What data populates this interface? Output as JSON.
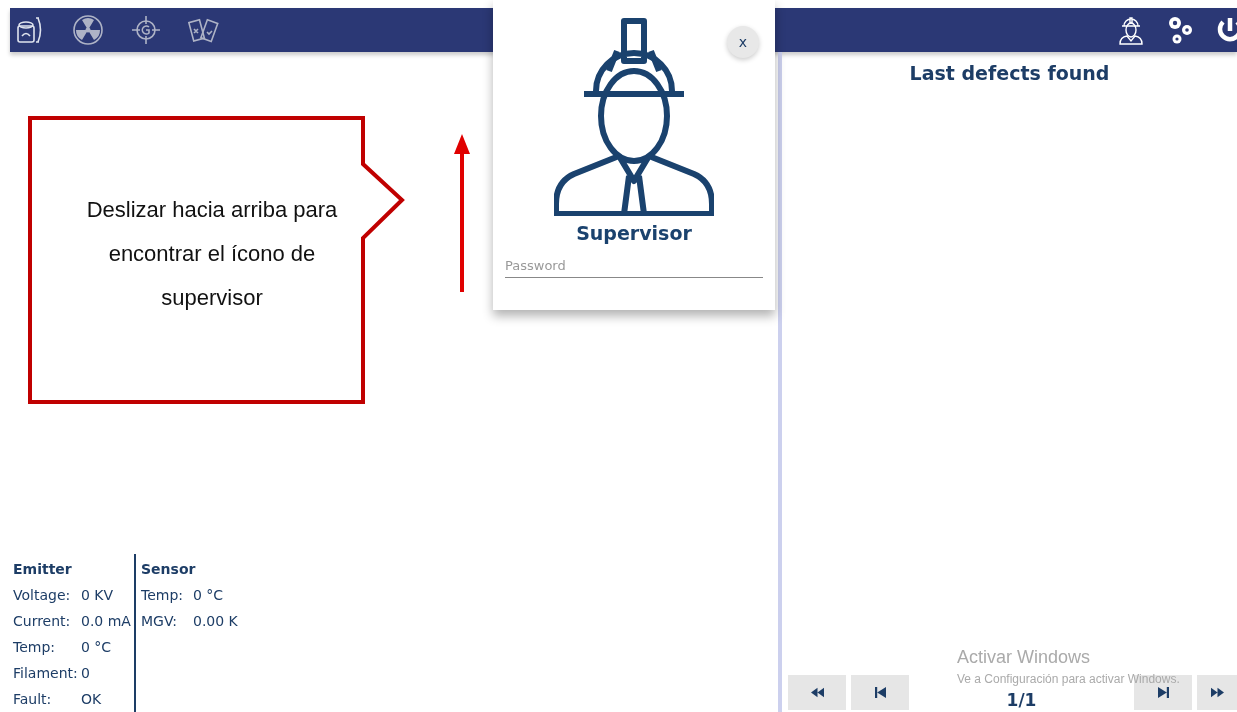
{
  "popup": {
    "title": "Supervisor",
    "password": {
      "placeholder": "Password"
    },
    "close": "x"
  },
  "annotation": {
    "text": "Deslizar hacia arriba para encontrar el ícono de supervisor"
  },
  "emitter": {
    "title": "Emitter",
    "rows": [
      {
        "label": "Voltage:",
        "value": "0 KV"
      },
      {
        "label": "Current:",
        "value": "0.0 mA"
      },
      {
        "label": "Temp:",
        "value": "0 °C"
      },
      {
        "label": "Filament:",
        "value": "0"
      },
      {
        "label": "Fault:",
        "value": "OK"
      }
    ]
  },
  "sensor": {
    "title": "Sensor",
    "rows": [
      {
        "label": "Temp:",
        "value": "0 °C"
      },
      {
        "label": "MGV:",
        "value": "0.00 K"
      }
    ]
  },
  "right_panel": {
    "title": "Last defects found",
    "page": "1/1"
  },
  "windows_notice": {
    "title": "Activar Windows",
    "message": "Ve a Configuración para activar Windows."
  }
}
